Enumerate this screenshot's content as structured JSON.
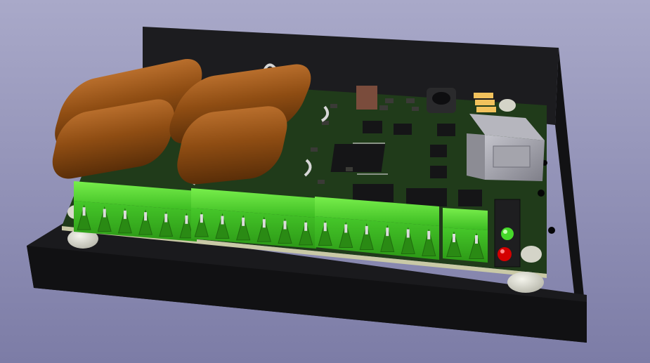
{
  "viewer": {
    "background_top": "#a9a9c9",
    "background_bottom": "#7c7ca6"
  },
  "board": {
    "enclosure_color": "#1b1b1d",
    "pcb_color": "#1f3a19",
    "capacitor_color": "#8a4a12",
    "connector_color": "#4ed430",
    "ic_color": "#151517",
    "usb_color": "#9a9aa2",
    "led_on_color": "#46d82a",
    "led_red_color": "#d40000",
    "smd_cap_color": "#f2c25c",
    "connector_blocks": [
      6,
      6,
      6,
      2
    ],
    "leds": [
      "green",
      "red"
    ]
  }
}
